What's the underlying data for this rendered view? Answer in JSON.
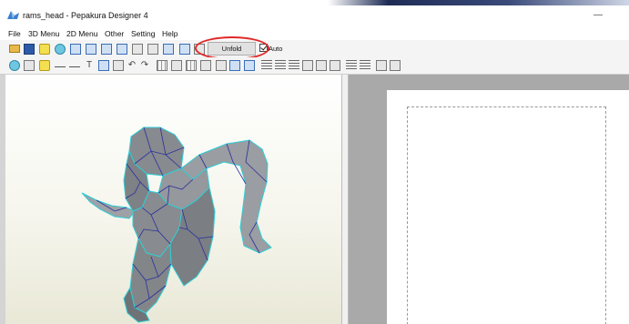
{
  "window": {
    "title": "rams_head - Pepakura Designer 4",
    "minimize_symbol": "—"
  },
  "menu": [
    {
      "id": "file",
      "label": "File"
    },
    {
      "id": "3d-menu",
      "label": "3D Menu"
    },
    {
      "id": "2d-menu",
      "label": "2D Menu"
    },
    {
      "id": "other",
      "label": "Other"
    },
    {
      "id": "setting",
      "label": "Setting"
    },
    {
      "id": "help",
      "label": "Help"
    }
  ],
  "toolbar": {
    "unfold_label": "Unfold",
    "auto_label": "Auto",
    "auto_checked": true,
    "text_tool_glyph": "T",
    "undo_glyph": "↶",
    "redo_glyph": "↷"
  },
  "colors": {
    "highlight": "#e02828",
    "model_face": "#8c8f93",
    "model_fold_edge": "#2ecfd6",
    "model_crease_edge": "#2b2f9e",
    "window_chrome": "#f0f0f0",
    "view2d_background": "#a9a9a9"
  }
}
